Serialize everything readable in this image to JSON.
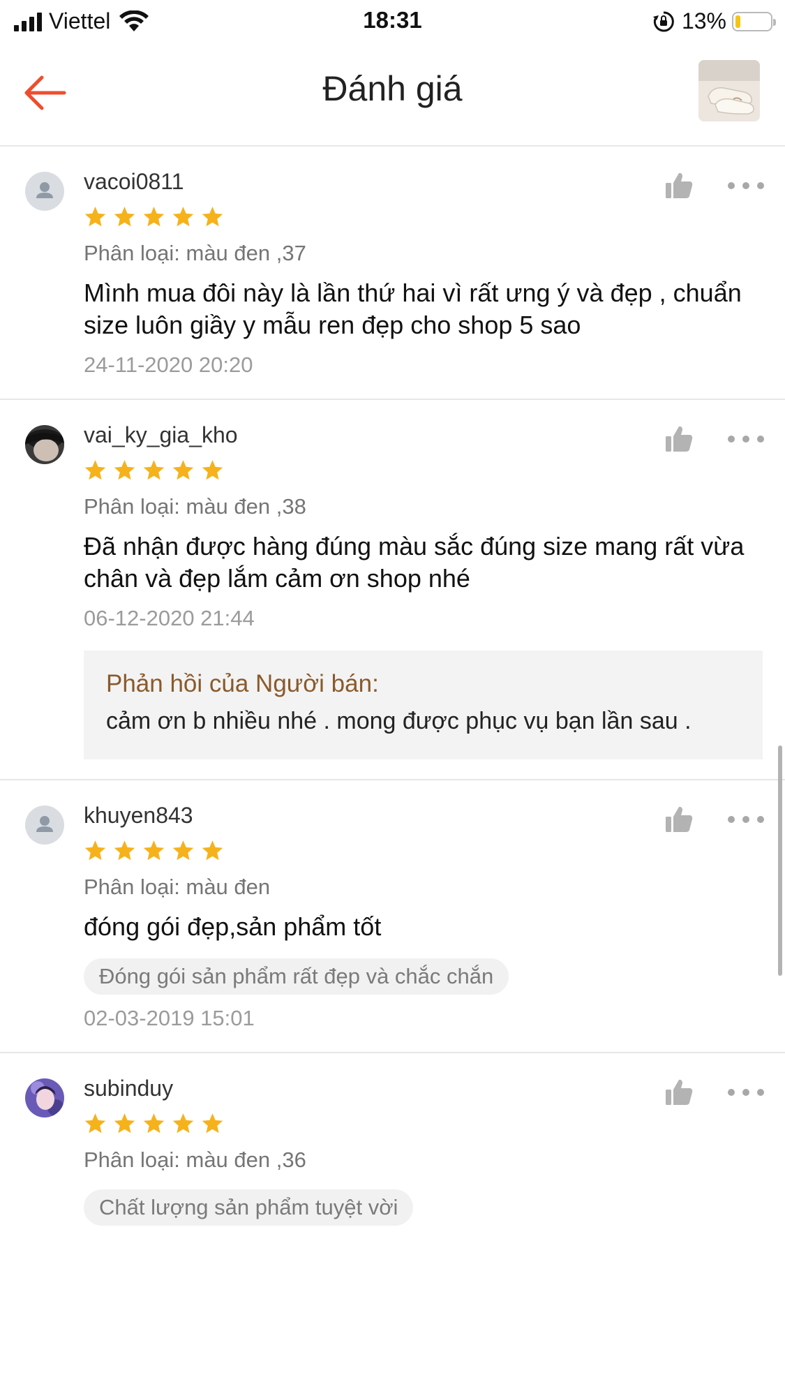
{
  "status_bar": {
    "carrier": "Viettel",
    "time": "18:31",
    "battery_percent": "13%",
    "battery_level": 0.13
  },
  "header": {
    "title": "Đánh giá",
    "back_icon": "arrow-left-icon",
    "accent_color": "#ee4d2d"
  },
  "reviews": [
    {
      "username": "vacoi0811",
      "rating": 5,
      "variant": "Phân loại: màu đen ,37",
      "comment": "Mình mua đôi này là lần thứ hai vì rất ưng ý và đẹp , chuẩn size luôn giầy y mẫu ren đẹp cho shop 5 sao",
      "date": "24-11-2020 20:20"
    },
    {
      "username": "vai_ky_gia_kho",
      "rating": 5,
      "variant": "Phân loại: màu đen ,38",
      "comment": "Đã nhận được hàng đúng màu sắc đúng size mang rất vừa chân và đẹp lắm cảm ơn shop nhé",
      "date": "06-12-2020 21:44",
      "seller_reply_title": "Phản hồi của Người bán:",
      "seller_reply": "cảm ơn b nhiều nhé . mong được phục vụ bạn lần sau ."
    },
    {
      "username": "khuyen843",
      "rating": 5,
      "variant": "Phân loại: màu đen",
      "comment": "đóng gói đẹp,sản phẩm tốt",
      "tag": "Đóng gói sản phẩm rất đẹp và chắc chắn",
      "date": "02-03-2019 15:01"
    },
    {
      "username": "subinduy",
      "rating": 5,
      "variant": "Phân loại: màu đen ,36",
      "tag": "Chất lượng sản phẩm tuyệt vời"
    }
  ],
  "colors": {
    "star": "#f6b21b",
    "seller_reply_title": "#8a5a2b",
    "divider": "#e6e6e6"
  }
}
